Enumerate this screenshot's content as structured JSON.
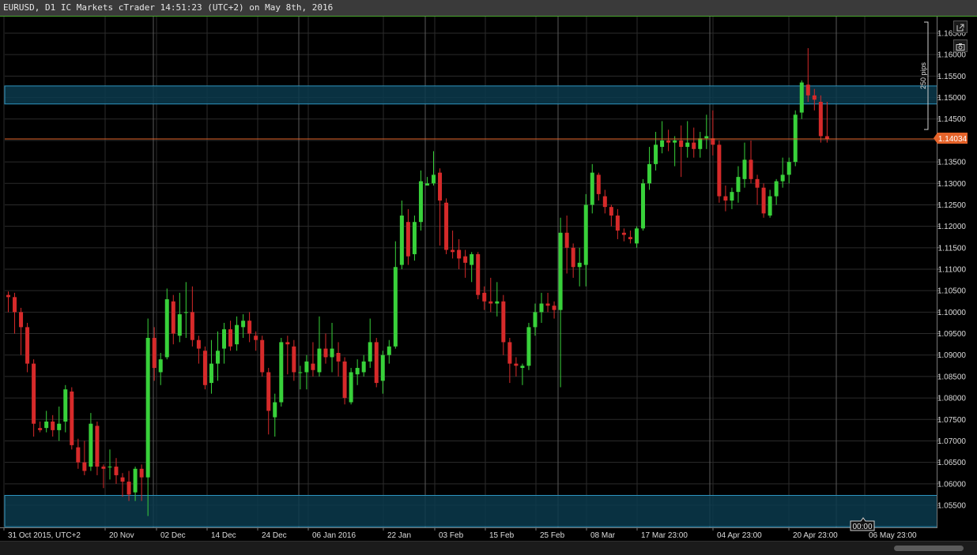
{
  "window": {
    "title": "EURUSD, D1 IC Markets cTrader 14:51:23 (UTC+2) on May 8th, 2016"
  },
  "toolbar": {
    "icons": [
      "detach-icon",
      "camera-icon"
    ]
  },
  "colors": {
    "background": "#000000",
    "bull": "#38d13a",
    "bear": "#d62a2a",
    "grid": "#2b2b2b",
    "zone_fill": "#0a3a4c",
    "zone_stroke": "#2e95bf",
    "price_line": "#e5632a",
    "price_tag": "#e5632a",
    "title_border": "#4aa62f"
  },
  "chart_data": {
    "type": "candlestick",
    "symbol": "EURUSD",
    "timeframe": "D1",
    "ylim": [
      1.052,
      1.1685
    ],
    "y_ticks": [
      "1.16500",
      "1.16000",
      "1.15500",
      "1.15000",
      "1.14500",
      "1.14000",
      "1.13500",
      "1.13000",
      "1.12500",
      "1.12000",
      "1.11500",
      "1.11000",
      "1.10500",
      "1.10000",
      "1.09500",
      "1.09000",
      "1.08500",
      "1.08000",
      "1.07500",
      "1.07000",
      "1.06500",
      "1.06000",
      "1.05500"
    ],
    "x_labels": [
      "31 Oct 2015, UTC+2",
      "20 Nov",
      "02 Dec",
      "14 Dec",
      "24 Dec",
      "06 Jan 2016",
      "22 Jan",
      "03 Feb",
      "15 Feb",
      "25 Feb",
      "08 Mar",
      "17 Mar 23:00",
      "04 Apr 23:00",
      "20 Apr 23:00",
      "06 May 23:00"
    ],
    "current_price": "1.14034",
    "time_marker": "00:00",
    "measure_label": "250 pips",
    "zones": [
      {
        "top": 1.1527,
        "bottom": 1.1485
      },
      {
        "top": 1.0573,
        "bottom": 1.05
      }
    ],
    "candles": [
      {
        "o": 1.104,
        "h": 1.1048,
        "l": 1.1,
        "c": 1.1035
      },
      {
        "o": 1.1035,
        "h": 1.1045,
        "l": 1.095,
        "c": 1.1
      },
      {
        "o": 1.1,
        "h": 1.101,
        "l": 1.09,
        "c": 1.0965
      },
      {
        "o": 1.0965,
        "h": 1.0975,
        "l": 1.086,
        "c": 1.088
      },
      {
        "o": 1.088,
        "h": 1.089,
        "l": 1.071,
        "c": 1.074
      },
      {
        "o": 1.073,
        "h": 1.0745,
        "l": 1.072,
        "c": 1.0725
      },
      {
        "o": 1.073,
        "h": 1.077,
        "l": 1.072,
        "c": 1.0745
      },
      {
        "o": 1.0745,
        "h": 1.076,
        "l": 1.071,
        "c": 1.0725
      },
      {
        "o": 1.0725,
        "h": 1.078,
        "l": 1.07,
        "c": 1.074
      },
      {
        "o": 1.0745,
        "h": 1.083,
        "l": 1.072,
        "c": 1.082
      },
      {
        "o": 1.0815,
        "h": 1.0825,
        "l": 1.068,
        "c": 1.069
      },
      {
        "o": 1.0685,
        "h": 1.0705,
        "l": 1.0635,
        "c": 1.065
      },
      {
        "o": 1.065,
        "h": 1.07,
        "l": 1.062,
        "c": 1.063
      },
      {
        "o": 1.064,
        "h": 1.0765,
        "l": 1.063,
        "c": 1.074
      },
      {
        "o": 1.0735,
        "h": 1.0745,
        "l": 1.062,
        "c": 1.064
      },
      {
        "o": 1.064,
        "h": 1.0645,
        "l": 1.059,
        "c": 1.0635
      },
      {
        "o": 1.064,
        "h": 1.068,
        "l": 1.061,
        "c": 1.064
      },
      {
        "o": 1.064,
        "h": 1.066,
        "l": 1.06,
        "c": 1.062
      },
      {
        "o": 1.0615,
        "h": 1.0625,
        "l": 1.057,
        "c": 1.0605
      },
      {
        "o": 1.0605,
        "h": 1.063,
        "l": 1.056,
        "c": 1.0575
      },
      {
        "o": 1.058,
        "h": 1.064,
        "l": 1.056,
        "c": 1.0635
      },
      {
        "o": 1.0635,
        "h": 1.0645,
        "l": 1.056,
        "c": 1.0615
      },
      {
        "o": 1.0615,
        "h": 1.0985,
        "l": 1.0525,
        "c": 1.094
      },
      {
        "o": 1.094,
        "h": 1.0965,
        "l": 1.084,
        "c": 1.087
      },
      {
        "o": 1.086,
        "h": 1.0905,
        "l": 1.083,
        "c": 1.089
      },
      {
        "o": 1.0895,
        "h": 1.1055,
        "l": 1.089,
        "c": 1.103
      },
      {
        "o": 1.1025,
        "h": 1.104,
        "l": 1.0925,
        "c": 1.095
      },
      {
        "o": 1.0945,
        "h": 1.1045,
        "l": 1.093,
        "c": 1.0995
      },
      {
        "o": 1.1,
        "h": 1.107,
        "l": 1.094,
        "c": 1.1
      },
      {
        "o": 1.1,
        "h": 1.106,
        "l": 1.092,
        "c": 1.0935
      },
      {
        "o": 1.0935,
        "h": 1.0945,
        "l": 1.088,
        "c": 1.0915
      },
      {
        "o": 1.091,
        "h": 1.092,
        "l": 1.082,
        "c": 1.083
      },
      {
        "o": 1.0835,
        "h": 1.0935,
        "l": 1.081,
        "c": 1.088
      },
      {
        "o": 1.088,
        "h": 1.0955,
        "l": 1.084,
        "c": 1.091
      },
      {
        "o": 1.0915,
        "h": 1.0975,
        "l": 1.088,
        "c": 1.096
      },
      {
        "o": 1.096,
        "h": 1.098,
        "l": 1.091,
        "c": 1.092
      },
      {
        "o": 1.0925,
        "h": 1.099,
        "l": 1.091,
        "c": 1.097
      },
      {
        "o": 1.0965,
        "h": 1.0995,
        "l": 1.094,
        "c": 1.098
      },
      {
        "o": 1.098,
        "h": 1.1,
        "l": 1.093,
        "c": 1.095
      },
      {
        "o": 1.0945,
        "h": 1.0955,
        "l": 1.091,
        "c": 1.0935
      },
      {
        "o": 1.0935,
        "h": 1.0945,
        "l": 1.085,
        "c": 1.086
      },
      {
        "o": 1.086,
        "h": 1.087,
        "l": 1.0715,
        "c": 1.077
      },
      {
        "o": 1.0755,
        "h": 1.081,
        "l": 1.071,
        "c": 1.079
      },
      {
        "o": 1.079,
        "h": 1.094,
        "l": 1.078,
        "c": 1.093
      },
      {
        "o": 1.093,
        "h": 1.0945,
        "l": 1.0855,
        "c": 1.0925
      },
      {
        "o": 1.092,
        "h": 1.0935,
        "l": 1.084,
        "c": 1.086
      },
      {
        "o": 1.086,
        "h": 1.0875,
        "l": 1.082,
        "c": 1.086
      },
      {
        "o": 1.086,
        "h": 1.09,
        "l": 1.082,
        "c": 1.0885
      },
      {
        "o": 1.088,
        "h": 1.093,
        "l": 1.085,
        "c": 1.0865
      },
      {
        "o": 1.086,
        "h": 1.099,
        "l": 1.085,
        "c": 1.0915
      },
      {
        "o": 1.0915,
        "h": 1.095,
        "l": 1.088,
        "c": 1.0895
      },
      {
        "o": 1.0895,
        "h": 1.0975,
        "l": 1.086,
        "c": 1.0915
      },
      {
        "o": 1.0905,
        "h": 1.093,
        "l": 1.085,
        "c": 1.0885
      },
      {
        "o": 1.0885,
        "h": 1.0895,
        "l": 1.0785,
        "c": 1.08
      },
      {
        "o": 1.079,
        "h": 1.087,
        "l": 1.0785,
        "c": 1.086
      },
      {
        "o": 1.0855,
        "h": 1.089,
        "l": 1.083,
        "c": 1.087
      },
      {
        "o": 1.086,
        "h": 1.09,
        "l": 1.085,
        "c": 1.0885
      },
      {
        "o": 1.0885,
        "h": 1.0985,
        "l": 1.087,
        "c": 1.093
      },
      {
        "o": 1.093,
        "h": 1.094,
        "l": 1.0825,
        "c": 1.0835
      },
      {
        "o": 1.084,
        "h": 1.091,
        "l": 1.081,
        "c": 1.09
      },
      {
        "o": 1.09,
        "h": 1.0935,
        "l": 1.088,
        "c": 1.092
      },
      {
        "o": 1.092,
        "h": 1.1165,
        "l": 1.0915,
        "c": 1.1105
      },
      {
        "o": 1.111,
        "h": 1.126,
        "l": 1.11,
        "c": 1.1225
      },
      {
        "o": 1.121,
        "h": 1.124,
        "l": 1.111,
        "c": 1.113
      },
      {
        "o": 1.1135,
        "h": 1.1225,
        "l": 1.112,
        "c": 1.121
      },
      {
        "o": 1.121,
        "h": 1.133,
        "l": 1.119,
        "c": 1.1305
      },
      {
        "o": 1.1295,
        "h": 1.1315,
        "l": 1.1295,
        "c": 1.13
      },
      {
        "o": 1.13,
        "h": 1.1375,
        "l": 1.1295,
        "c": 1.132
      },
      {
        "o": 1.1325,
        "h": 1.1335,
        "l": 1.1155,
        "c": 1.126
      },
      {
        "o": 1.1255,
        "h": 1.1265,
        "l": 1.1135,
        "c": 1.1145
      },
      {
        "o": 1.1145,
        "h": 1.119,
        "l": 1.1125,
        "c": 1.114
      },
      {
        "o": 1.1145,
        "h": 1.117,
        "l": 1.11,
        "c": 1.1125
      },
      {
        "o": 1.113,
        "h": 1.1145,
        "l": 1.108,
        "c": 1.1115
      },
      {
        "o": 1.111,
        "h": 1.114,
        "l": 1.107,
        "c": 1.1135
      },
      {
        "o": 1.1135,
        "h": 1.114,
        "l": 1.103,
        "c": 1.104
      },
      {
        "o": 1.1045,
        "h": 1.106,
        "l": 1.1005,
        "c": 1.1025
      },
      {
        "o": 1.1025,
        "h": 1.108,
        "l": 1.1,
        "c": 1.102
      },
      {
        "o": 1.102,
        "h": 1.107,
        "l": 1.099,
        "c": 1.1025
      },
      {
        "o": 1.1025,
        "h": 1.104,
        "l": 1.09,
        "c": 1.093
      },
      {
        "o": 1.093,
        "h": 1.094,
        "l": 1.0835,
        "c": 1.088
      },
      {
        "o": 1.088,
        "h": 1.0895,
        "l": 1.085,
        "c": 1.0875
      },
      {
        "o": 1.087,
        "h": 1.088,
        "l": 1.083,
        "c": 1.0875
      },
      {
        "o": 1.0875,
        "h": 1.0975,
        "l": 1.0865,
        "c": 1.0965
      },
      {
        "o": 1.0965,
        "h": 1.102,
        "l": 1.0945,
        "c": 1.1
      },
      {
        "o": 1.1,
        "h": 1.1045,
        "l": 1.0975,
        "c": 1.102
      },
      {
        "o": 1.102,
        "h": 1.1045,
        "l": 1.1,
        "c": 1.1015
      },
      {
        "o": 1.1015,
        "h": 1.1025,
        "l": 1.0985,
        "c": 1.1005
      },
      {
        "o": 1.1005,
        "h": 1.122,
        "l": 1.0825,
        "c": 1.1185
      },
      {
        "o": 1.1185,
        "h": 1.1225,
        "l": 1.109,
        "c": 1.115
      },
      {
        "o": 1.115,
        "h": 1.116,
        "l": 1.108,
        "c": 1.1105
      },
      {
        "o": 1.1105,
        "h": 1.115,
        "l": 1.106,
        "c": 1.1115
      },
      {
        "o": 1.111,
        "h": 1.1275,
        "l": 1.106,
        "c": 1.125
      },
      {
        "o": 1.125,
        "h": 1.1345,
        "l": 1.123,
        "c": 1.1325
      },
      {
        "o": 1.132,
        "h": 1.1325,
        "l": 1.126,
        "c": 1.1275
      },
      {
        "o": 1.127,
        "h": 1.1285,
        "l": 1.123,
        "c": 1.1245
      },
      {
        "o": 1.1245,
        "h": 1.125,
        "l": 1.12,
        "c": 1.1225
      },
      {
        "o": 1.1225,
        "h": 1.124,
        "l": 1.117,
        "c": 1.119
      },
      {
        "o": 1.1185,
        "h": 1.1195,
        "l": 1.1165,
        "c": 1.118
      },
      {
        "o": 1.1175,
        "h": 1.119,
        "l": 1.116,
        "c": 1.117
      },
      {
        "o": 1.116,
        "h": 1.12,
        "l": 1.115,
        "c": 1.1195
      },
      {
        "o": 1.1195,
        "h": 1.131,
        "l": 1.119,
        "c": 1.13
      },
      {
        "o": 1.13,
        "h": 1.1385,
        "l": 1.1285,
        "c": 1.1345
      },
      {
        "o": 1.1345,
        "h": 1.142,
        "l": 1.133,
        "c": 1.139
      },
      {
        "o": 1.1385,
        "h": 1.1445,
        "l": 1.137,
        "c": 1.14
      },
      {
        "o": 1.14,
        "h": 1.1425,
        "l": 1.1375,
        "c": 1.1395
      },
      {
        "o": 1.1395,
        "h": 1.141,
        "l": 1.134,
        "c": 1.14
      },
      {
        "o": 1.14,
        "h": 1.1435,
        "l": 1.1315,
        "c": 1.1385
      },
      {
        "o": 1.1385,
        "h": 1.1445,
        "l": 1.136,
        "c": 1.1395
      },
      {
        "o": 1.1395,
        "h": 1.143,
        "l": 1.136,
        "c": 1.138
      },
      {
        "o": 1.138,
        "h": 1.142,
        "l": 1.136,
        "c": 1.1405
      },
      {
        "o": 1.1405,
        "h": 1.146,
        "l": 1.138,
        "c": 1.141
      },
      {
        "o": 1.1405,
        "h": 1.147,
        "l": 1.1365,
        "c": 1.139
      },
      {
        "o": 1.139,
        "h": 1.14,
        "l": 1.1255,
        "c": 1.127
      },
      {
        "o": 1.127,
        "h": 1.1295,
        "l": 1.1235,
        "c": 1.126
      },
      {
        "o": 1.126,
        "h": 1.129,
        "l": 1.124,
        "c": 1.128
      },
      {
        "o": 1.128,
        "h": 1.134,
        "l": 1.1255,
        "c": 1.1315
      },
      {
        "o": 1.131,
        "h": 1.1395,
        "l": 1.129,
        "c": 1.1355
      },
      {
        "o": 1.1355,
        "h": 1.14,
        "l": 1.13,
        "c": 1.131
      },
      {
        "o": 1.131,
        "h": 1.132,
        "l": 1.125,
        "c": 1.129
      },
      {
        "o": 1.129,
        "h": 1.13,
        "l": 1.122,
        "c": 1.123
      },
      {
        "o": 1.1225,
        "h": 1.1285,
        "l": 1.122,
        "c": 1.127
      },
      {
        "o": 1.127,
        "h": 1.131,
        "l": 1.125,
        "c": 1.1305
      },
      {
        "o": 1.1305,
        "h": 1.136,
        "l": 1.129,
        "c": 1.132
      },
      {
        "o": 1.132,
        "h": 1.136,
        "l": 1.13,
        "c": 1.135
      },
      {
        "o": 1.135,
        "h": 1.147,
        "l": 1.134,
        "c": 1.146
      },
      {
        "o": 1.1465,
        "h": 1.154,
        "l": 1.145,
        "c": 1.1535
      },
      {
        "o": 1.153,
        "h": 1.1615,
        "l": 1.149,
        "c": 1.1505
      },
      {
        "o": 1.1505,
        "h": 1.152,
        "l": 1.147,
        "c": 1.1495
      },
      {
        "o": 1.149,
        "h": 1.1505,
        "l": 1.1395,
        "c": 1.141
      },
      {
        "o": 1.141,
        "h": 1.149,
        "l": 1.1395,
        "c": 1.1403
      }
    ]
  }
}
